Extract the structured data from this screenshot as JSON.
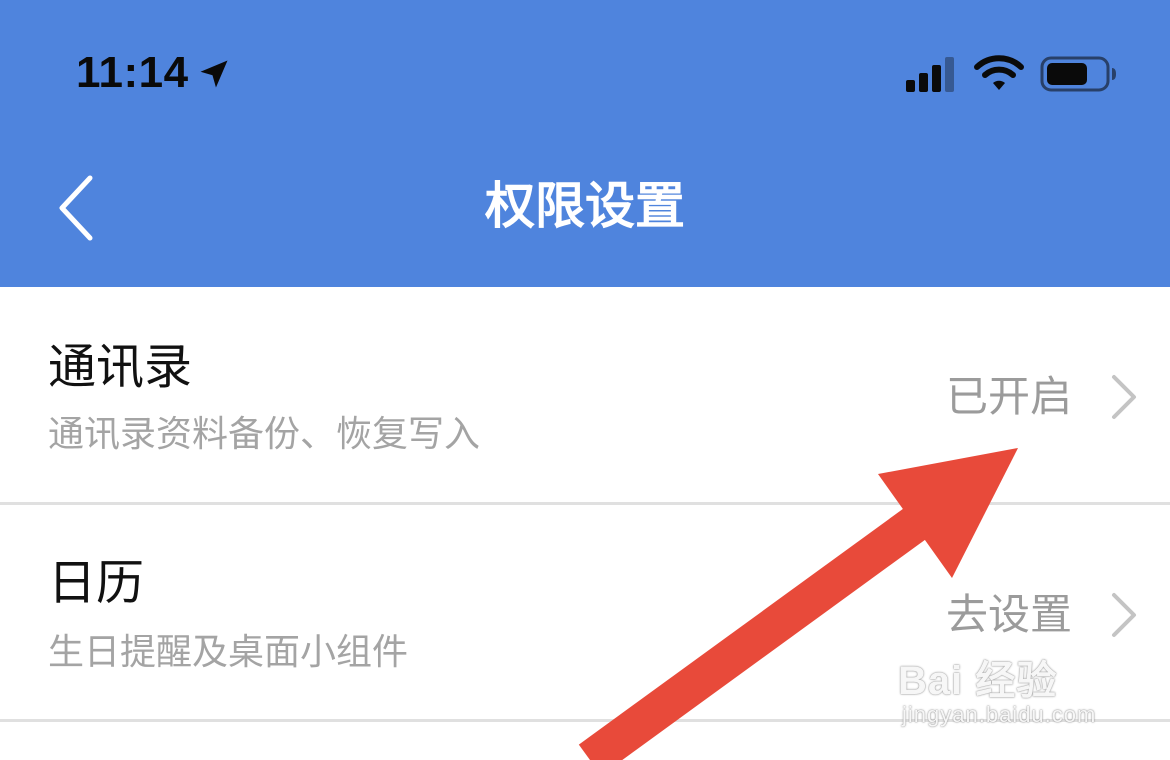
{
  "status_bar": {
    "time": "11:14"
  },
  "nav": {
    "title": "权限设置"
  },
  "rows": [
    {
      "title": "通讯录",
      "description": "通讯录资料备份、恢复写入",
      "status": "已开启"
    },
    {
      "title": "日历",
      "description": "生日提醒及桌面小组件",
      "status": "去设置"
    }
  ],
  "watermark": {
    "text": "Bai 经验",
    "sub": "jingyan.baidu.com"
  },
  "colors": {
    "header": "#4f84dd",
    "arrow": "#e84a3a",
    "muted_text": "#a4a4a4"
  },
  "icons": [
    "location-arrow-icon",
    "signal-icon",
    "wifi-icon",
    "battery-icon",
    "back-chevron-icon",
    "chevron-right-icon"
  ]
}
